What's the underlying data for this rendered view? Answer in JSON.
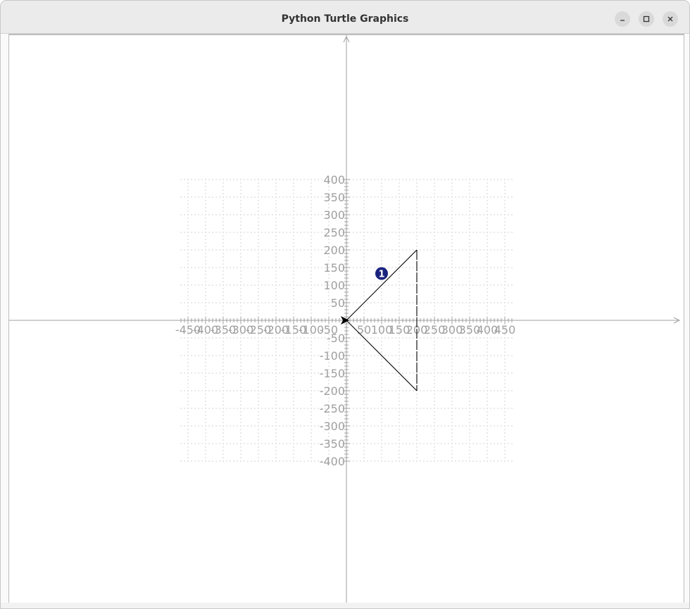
{
  "window": {
    "title": "Python Turtle Graphics",
    "controls": {
      "minimize_icon": "minimize-icon",
      "maximize_icon": "maximize-icon",
      "close_icon": "close-icon"
    }
  },
  "canvas": {
    "x_ticks": [
      "-450",
      "-400",
      "-350",
      "-300",
      "-250",
      "-200",
      "-150",
      "-100",
      "-50",
      "50",
      "100",
      "150",
      "200",
      "250",
      "300",
      "350",
      "400",
      "450"
    ],
    "y_ticks": [
      "400",
      "350",
      "300",
      "250",
      "200",
      "150",
      "100",
      "50",
      "-50",
      "-100",
      "-150",
      "-200",
      "-250",
      "-300",
      "-350",
      "-400"
    ],
    "triangle": {
      "points": [
        [
          0,
          0
        ],
        [
          200,
          200
        ],
        [
          200,
          -200
        ]
      ],
      "vertical_edge_dashed": true
    },
    "marker": {
      "label": "1",
      "x": 100,
      "y": 133,
      "color": "#1a237e"
    },
    "turtle": {
      "x": 0,
      "y": 0,
      "heading": 0,
      "color": "#000000"
    },
    "colors": {
      "axis": "#a0a0a0",
      "grid": "#b5b5b5",
      "label": "#a0a0a0",
      "shape": "#000000"
    }
  }
}
